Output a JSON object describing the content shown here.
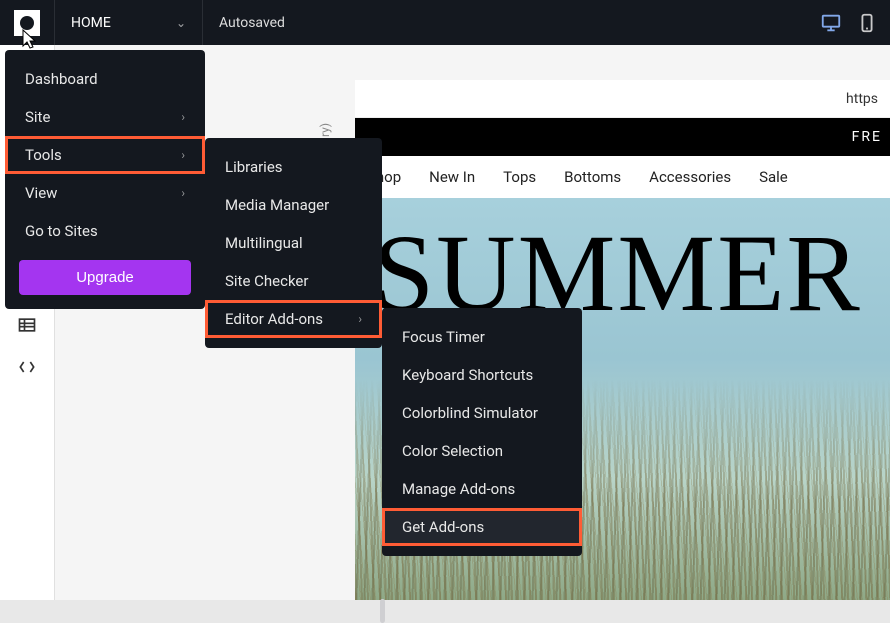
{
  "topbar": {
    "home_label": "HOME",
    "status": "Autosaved"
  },
  "main_menu": {
    "items": [
      {
        "label": "Dashboard",
        "has_children": false
      },
      {
        "label": "Site",
        "has_children": true
      },
      {
        "label": "Tools",
        "has_children": true,
        "highlighted": true
      },
      {
        "label": "View",
        "has_children": true
      },
      {
        "label": "Go to Sites",
        "has_children": false
      }
    ],
    "upgrade_label": "Upgrade"
  },
  "tools_menu": {
    "items": [
      {
        "label": "Libraries"
      },
      {
        "label": "Media Manager"
      },
      {
        "label": "Multilingual"
      },
      {
        "label": "Site Checker"
      },
      {
        "label": "Editor Add-ons",
        "has_children": true,
        "highlighted": true
      }
    ]
  },
  "addons_menu": {
    "items": [
      {
        "label": "Focus Timer"
      },
      {
        "label": "Keyboard Shortcuts"
      },
      {
        "label": "Colorblind Simulator"
      },
      {
        "label": "Color Selection"
      },
      {
        "label": "Manage Add-ons"
      },
      {
        "label": "Get Add-ons",
        "highlighted": true,
        "hover": true
      }
    ]
  },
  "sidebar_rotated_label": "ry)",
  "preview": {
    "url_fragment": "https",
    "banner_text": "FRE",
    "nav": [
      "Shop",
      "New In",
      "Tops",
      "Bottoms",
      "Accessories",
      "Sale"
    ],
    "hero_title": "SUMMER"
  },
  "colors": {
    "highlight": "#ff5c35",
    "upgrade": "#a435f0",
    "panel": "#14181f"
  }
}
